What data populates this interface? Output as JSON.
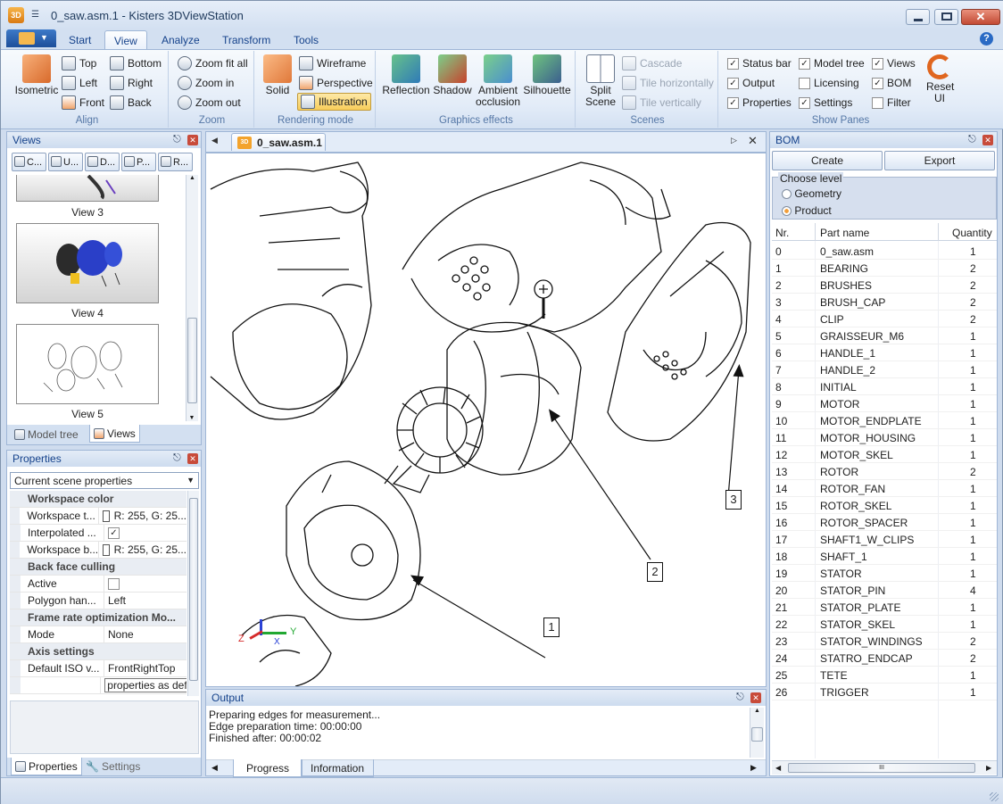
{
  "window": {
    "title": "0_saw.asm.1 - Kisters 3DViewStation"
  },
  "ribbon_tabs": [
    {
      "label": "Start",
      "active": false
    },
    {
      "label": "View",
      "active": true
    },
    {
      "label": "Analyze",
      "active": false
    },
    {
      "label": "Transform",
      "active": false
    },
    {
      "label": "Tools",
      "active": false
    }
  ],
  "ribbon": {
    "align": {
      "name": "Align",
      "isometric": "Isometric",
      "top": "Top",
      "left": "Left",
      "front": "Front",
      "bottom": "Bottom",
      "right": "Right",
      "back": "Back"
    },
    "zoom": {
      "name": "Zoom",
      "fit_all": "Zoom fit all",
      "zoom_in": "Zoom in",
      "zoom_out": "Zoom out"
    },
    "rendering": {
      "name": "Rendering mode",
      "solid": "Solid",
      "wireframe": "Wireframe",
      "perspective": "Perspective",
      "illustration": "Illustration"
    },
    "effects": {
      "name": "Graphics effects",
      "reflection": "Reflection",
      "shadow": "Shadow",
      "ambient": "Ambient occlusion",
      "silhouette": "Silhouette"
    },
    "scenes": {
      "name": "Scenes",
      "split": "Split Scene",
      "cascade": "Cascade",
      "tile_h": "Tile horizontally",
      "tile_v": "Tile vertically"
    },
    "panes": {
      "name": "Show Panes",
      "status_bar": "Status bar",
      "output": "Output",
      "properties": "Properties",
      "model_tree": "Model tree",
      "licensing": "Licensing",
      "settings": "Settings",
      "views": "Views",
      "bom": "BOM",
      "filter": "Filter",
      "reset": "Reset UI"
    }
  },
  "views_panel": {
    "title": "Views",
    "toolbar": [
      "C...",
      "U...",
      "D...",
      "P...",
      "R..."
    ],
    "items": [
      "View 3",
      "View 4",
      "View 5"
    ],
    "tabs": [
      "Model tree",
      "Views"
    ]
  },
  "properties_panel": {
    "title": "Properties",
    "selector": "Current scene properties",
    "rows": [
      {
        "type": "cat",
        "label": "Workspace color"
      },
      {
        "type": "prop",
        "label": "Workspace t...",
        "value": "R: 255, G: 25...",
        "swatch": true
      },
      {
        "type": "prop",
        "label": "Interpolated ...",
        "value": "",
        "check": "✓"
      },
      {
        "type": "prop",
        "label": "Workspace b...",
        "value": "R: 255, G: 25...",
        "swatch": true
      },
      {
        "type": "cat",
        "label": "Back face culling"
      },
      {
        "type": "prop",
        "label": "Active",
        "value": "",
        "check": ""
      },
      {
        "type": "prop",
        "label": "Polygon han...",
        "value": "Left"
      },
      {
        "type": "cat",
        "label": "Frame rate optimization Mo..."
      },
      {
        "type": "prop",
        "label": "Mode",
        "value": "None"
      },
      {
        "type": "cat",
        "label": "Axis settings"
      },
      {
        "type": "prop",
        "label": "Default ISO v...",
        "value": "FrontRightTop"
      },
      {
        "type": "prop",
        "label": "",
        "value": "properties as def"
      }
    ],
    "tabs": [
      "Properties",
      "Settings"
    ]
  },
  "document": {
    "tab": "0_saw.asm.1",
    "callouts": [
      "1",
      "2",
      "3"
    ],
    "axis": {
      "x": "X",
      "y": "Y",
      "z": "Z"
    }
  },
  "output_panel": {
    "title": "Output",
    "lines": [
      "Preparing edges for measurement...",
      "Edge preparation time: 00:00:00",
      "Finished after: 00:00:02"
    ],
    "tabs": [
      "Progress",
      "Information"
    ]
  },
  "bom": {
    "title": "BOM",
    "create": "Create",
    "export": "Export",
    "choose_level": "Choose level",
    "geometry": "Geometry",
    "product": "Product",
    "headers": {
      "nr": "Nr.",
      "part": "Part name",
      "qty": "Quantity"
    },
    "rows": [
      [
        "0",
        "0_saw.asm",
        "1"
      ],
      [
        "1",
        "BEARING",
        "2"
      ],
      [
        "2",
        "BRUSHES",
        "2"
      ],
      [
        "3",
        "BRUSH_CAP",
        "2"
      ],
      [
        "4",
        "CLIP",
        "2"
      ],
      [
        "5",
        "GRAISSEUR_M6",
        "1"
      ],
      [
        "6",
        "HANDLE_1",
        "1"
      ],
      [
        "7",
        "HANDLE_2",
        "1"
      ],
      [
        "8",
        "INITIAL",
        "1"
      ],
      [
        "9",
        "MOTOR",
        "1"
      ],
      [
        "10",
        "MOTOR_ENDPLATE",
        "1"
      ],
      [
        "11",
        "MOTOR_HOUSING",
        "1"
      ],
      [
        "12",
        "MOTOR_SKEL",
        "1"
      ],
      [
        "13",
        "ROTOR",
        "2"
      ],
      [
        "14",
        "ROTOR_FAN",
        "1"
      ],
      [
        "15",
        "ROTOR_SKEL",
        "1"
      ],
      [
        "16",
        "ROTOR_SPACER",
        "1"
      ],
      [
        "17",
        "SHAFT1_W_CLIPS",
        "1"
      ],
      [
        "18",
        "SHAFT_1",
        "1"
      ],
      [
        "19",
        "STATOR",
        "1"
      ],
      [
        "20",
        "STATOR_PIN",
        "4"
      ],
      [
        "21",
        "STATOR_PLATE",
        "1"
      ],
      [
        "22",
        "STATOR_SKEL",
        "1"
      ],
      [
        "23",
        "STATOR_WINDINGS",
        "2"
      ],
      [
        "24",
        "STATRO_ENDCAP",
        "2"
      ],
      [
        "25",
        "TETE",
        "1"
      ],
      [
        "26",
        "TRIGGER",
        "1"
      ]
    ]
  },
  "colors": {
    "accent": "#15428b",
    "ribbon_bg": "#e3ecf8",
    "active_button": "#fbd86a"
  }
}
